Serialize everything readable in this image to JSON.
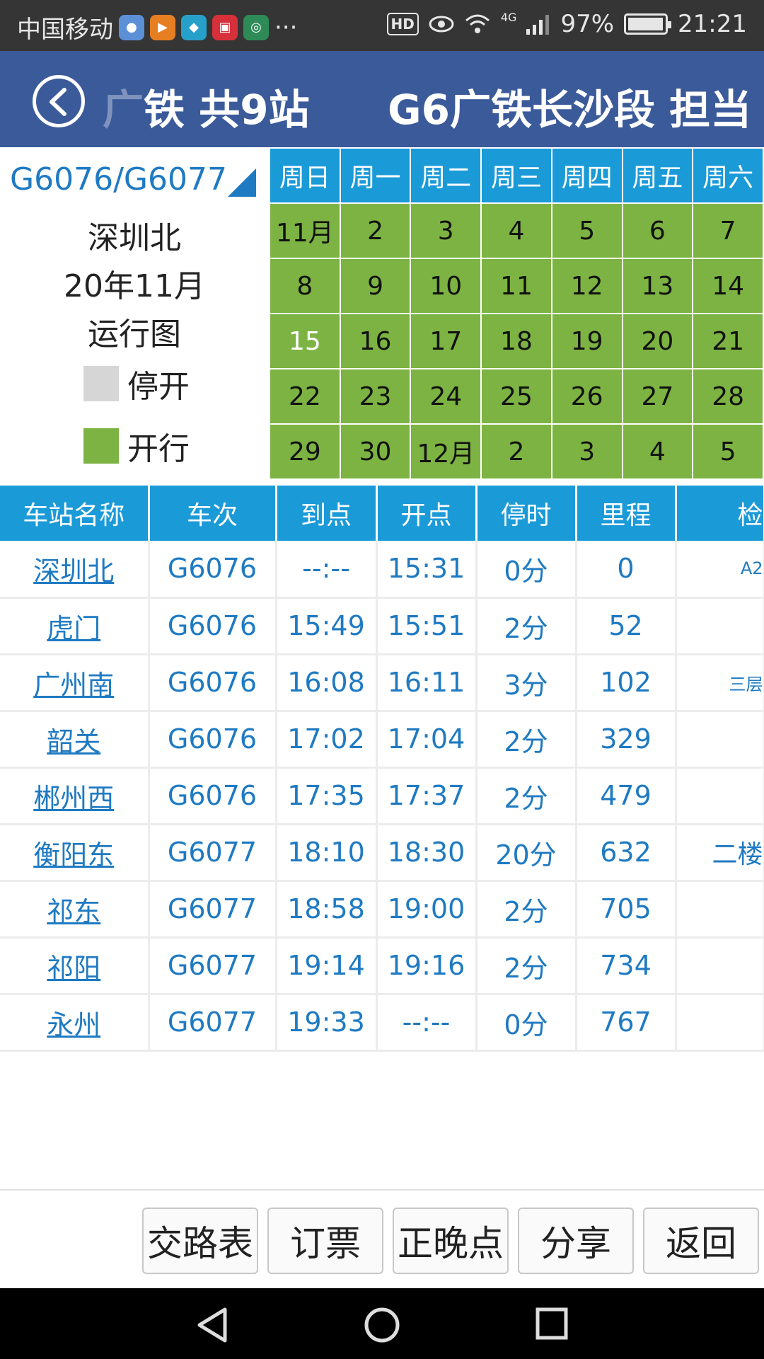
{
  "status_bar": {
    "carrier": "中国移动",
    "more": "···",
    "hd": "HD",
    "signal_label": "4G",
    "battery_text": "97%",
    "battery_level": 0.97,
    "time": "21:21"
  },
  "header": {
    "title_left_fade": "广",
    "title_left": "铁 共9站",
    "title_right_fade": "G6",
    "title_right": "广铁长沙段 担当"
  },
  "info": {
    "train_number": "G6076/G6077",
    "station": "深圳北",
    "month": "20年11月",
    "label": "运行图",
    "legend_stop": "停开",
    "legend_run": "开行",
    "color_stop": "#d6d6d6",
    "color_run": "#7cb342"
  },
  "calendar": {
    "weekdays": [
      "周日",
      "周一",
      "周二",
      "周三",
      "周四",
      "周五",
      "周六"
    ],
    "rows": [
      [
        "11月",
        "2",
        "3",
        "4",
        "5",
        "6",
        "7"
      ],
      [
        "8",
        "9",
        "10",
        "11",
        "12",
        "13",
        "14"
      ],
      [
        "15",
        "16",
        "17",
        "18",
        "19",
        "20",
        "21"
      ],
      [
        "22",
        "23",
        "24",
        "25",
        "26",
        "27",
        "28"
      ],
      [
        "29",
        "30",
        "12月",
        "2",
        "3",
        "4",
        "5"
      ]
    ]
  },
  "schedule": {
    "headers": [
      "车站名称",
      "车次",
      "到点",
      "开点",
      "停时",
      "里程",
      "检"
    ],
    "rows": [
      {
        "station": "深圳北",
        "train": "G6076",
        "arrive": "--:--",
        "depart": "15:31",
        "stop": "0分",
        "mileage": "0",
        "note": "A2"
      },
      {
        "station": "虎门",
        "train": "G6076",
        "arrive": "15:49",
        "depart": "15:51",
        "stop": "2分",
        "mileage": "52",
        "note": ""
      },
      {
        "station": "广州南",
        "train": "G6076",
        "arrive": "16:08",
        "depart": "16:11",
        "stop": "3分",
        "mileage": "102",
        "note": "三层"
      },
      {
        "station": "韶关",
        "train": "G6076",
        "arrive": "17:02",
        "depart": "17:04",
        "stop": "2分",
        "mileage": "329",
        "note": ""
      },
      {
        "station": "郴州西",
        "train": "G6076",
        "arrive": "17:35",
        "depart": "17:37",
        "stop": "2分",
        "mileage": "479",
        "note": ""
      },
      {
        "station": "衡阳东",
        "train": "G6077",
        "arrive": "18:10",
        "depart": "18:30",
        "stop": "20分",
        "mileage": "632",
        "note": "二楼"
      },
      {
        "station": "祁东",
        "train": "G6077",
        "arrive": "18:58",
        "depart": "19:00",
        "stop": "2分",
        "mileage": "705",
        "note": ""
      },
      {
        "station": "祁阳",
        "train": "G6077",
        "arrive": "19:14",
        "depart": "19:16",
        "stop": "2分",
        "mileage": "734",
        "note": ""
      },
      {
        "station": "永州",
        "train": "G6077",
        "arrive": "19:33",
        "depart": "--:--",
        "stop": "0分",
        "mileage": "767",
        "note": ""
      }
    ]
  },
  "buttons": {
    "route_table": "交路表",
    "book_ticket": "订票",
    "punctuality": "正晚点",
    "share": "分享",
    "back": "返回"
  }
}
